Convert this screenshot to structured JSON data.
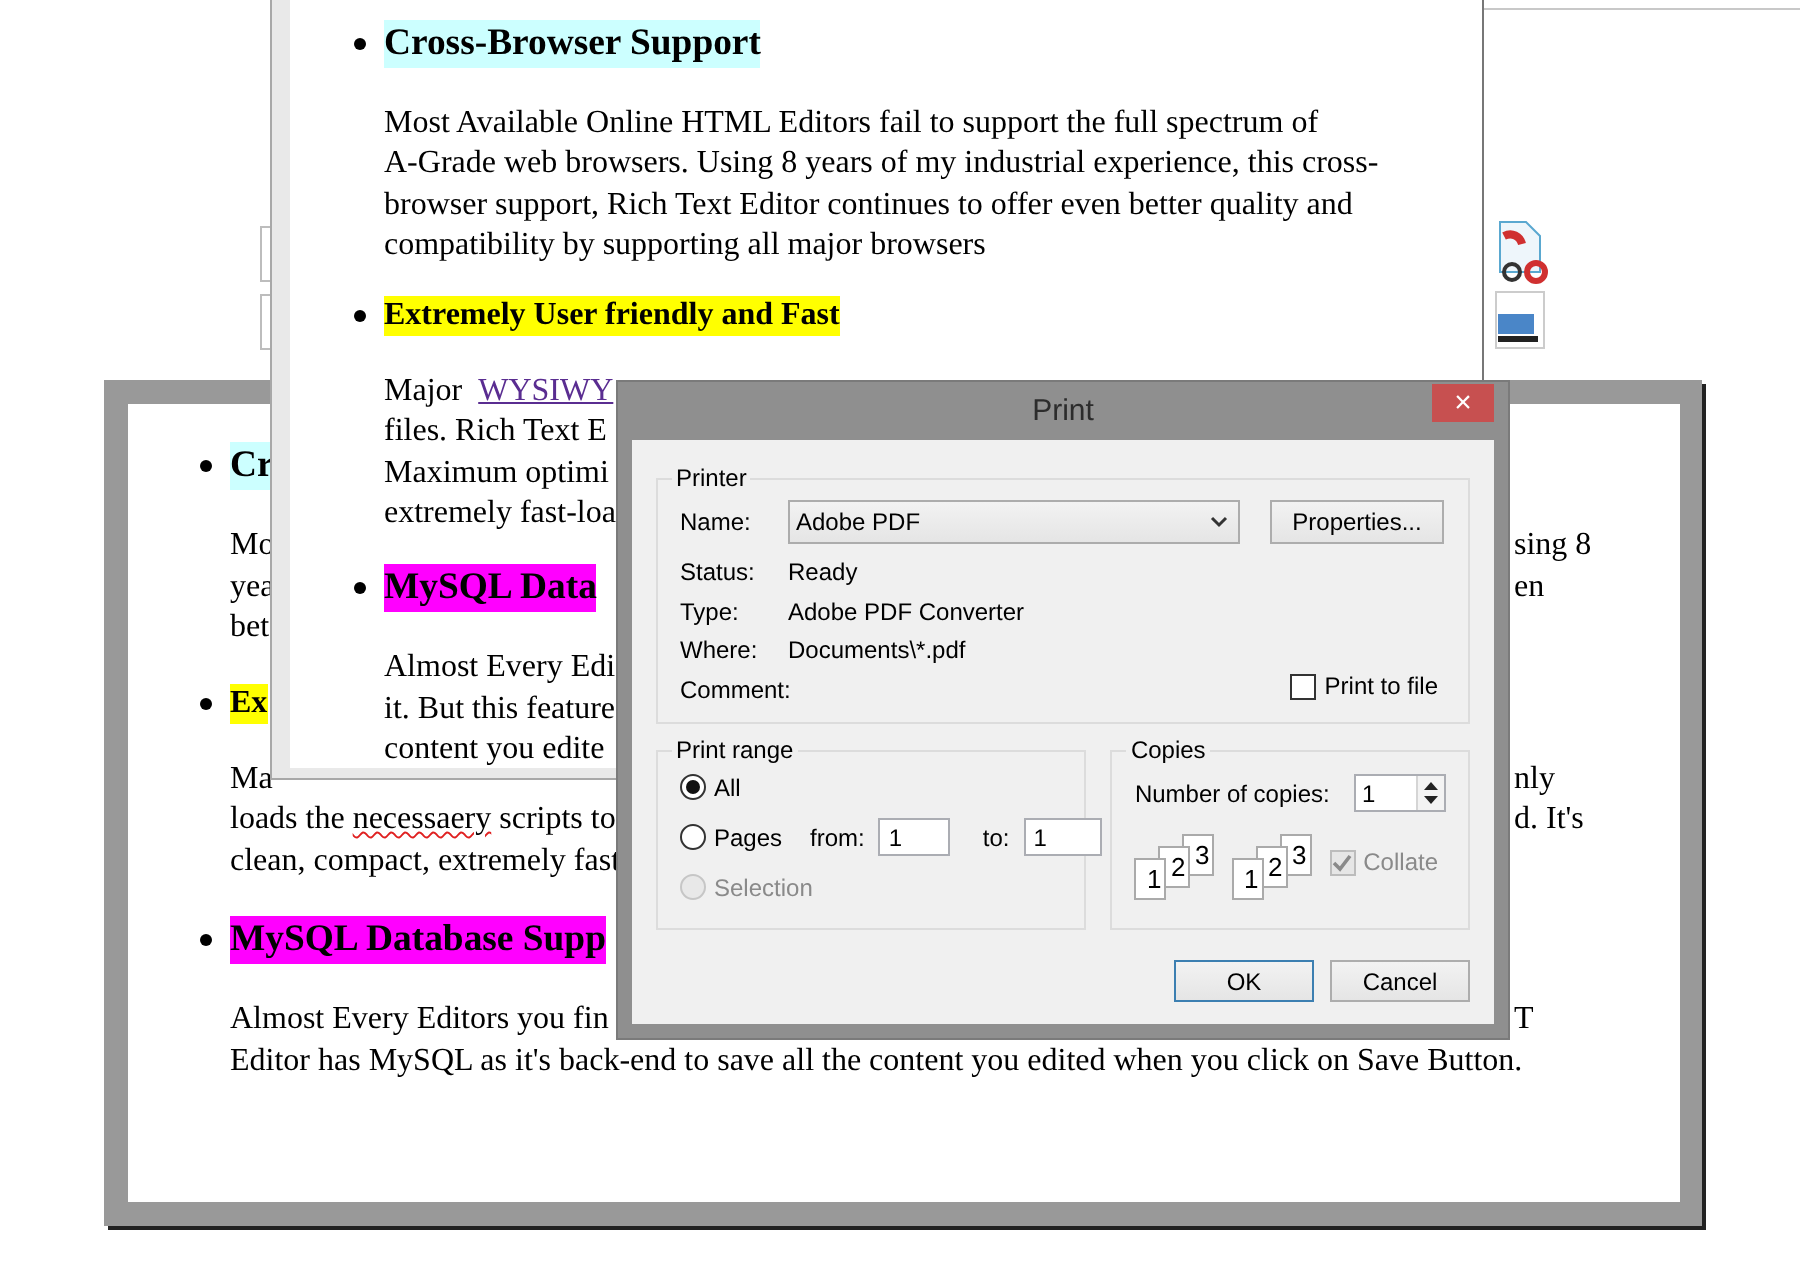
{
  "preview_page": {
    "items": [
      {
        "kind": "heading",
        "color": "#ccffff",
        "text": "Cr"
      },
      {
        "kind": "paragraph",
        "lines": [
          {
            "segments": [
              {
                "kind": "plain",
                "text": "Mo"
              }
            ],
            "right": "sing 8"
          },
          {
            "segments": [
              {
                "kind": "plain",
                "text": "yea"
              }
            ],
            "right": "en"
          },
          {
            "segments": [
              {
                "kind": "plain",
                "text": "bet"
              }
            ]
          }
        ]
      },
      {
        "kind": "subheading",
        "color": "#ffff00",
        "text": "Ex"
      },
      {
        "kind": "paragraph",
        "lines": [
          {
            "segments": [
              {
                "kind": "plain",
                "text": "Ma"
              }
            ],
            "right": "nly"
          },
          {
            "segments": [
              {
                "kind": "plain",
                "text": "loads the "
              },
              {
                "kind": "misspelled",
                "text": "necessaery"
              },
              {
                "kind": "plain",
                "text": " scripts to"
              }
            ],
            "right": "d. It's"
          },
          {
            "segments": [
              {
                "kind": "plain",
                "text": "clean, compact, extremely fast"
              }
            ]
          }
        ]
      },
      {
        "kind": "heading",
        "color": "#ff00ff",
        "text": "MySQL Database Supp"
      },
      {
        "kind": "paragraph",
        "lines": [
          {
            "segments": [
              {
                "kind": "plain",
                "text": "Almost Every Editors you fin"
              }
            ],
            "right": "T"
          },
          {
            "segments": [
              {
                "kind": "plain",
                "text": "Editor has MySQL as it's back-end to save all the content you edited when you click on Save Button."
              }
            ]
          }
        ]
      }
    ]
  },
  "editor_window": {
    "items": [
      {
        "kind": "heading",
        "color": "#ccffff",
        "text": "Cross-Browser Support"
      },
      {
        "kind": "paragraph",
        "lines": [
          {
            "segments": [
              {
                "kind": "plain",
                "text": "Most Available Online HTML Editors fail to support the full spectrum of"
              }
            ]
          },
          {
            "segments": [
              {
                "kind": "plain",
                "text": "A-Grade web browsers. Using 8 years of my industrial experience, this cross-"
              }
            ]
          },
          {
            "segments": [
              {
                "kind": "plain",
                "text": "browser support, Rich Text Editor continues to offer even better quality and"
              }
            ]
          },
          {
            "segments": [
              {
                "kind": "plain",
                "text": "compatibility by supporting all major browsers"
              }
            ]
          }
        ]
      },
      {
        "kind": "subheading",
        "color": "#ffff00",
        "text": "Extremely User friendly and Fast"
      },
      {
        "kind": "paragraph",
        "lines": [
          {
            "segments": [
              {
                "kind": "plain",
                "text": "Major  "
              },
              {
                "kind": "link",
                "text": "WYSIWY"
              }
            ]
          },
          {
            "segments": [
              {
                "kind": "plain",
                "text": "files. Rich Text E"
              }
            ]
          },
          {
            "segments": [
              {
                "kind": "plain",
                "text": "Maximum optimi"
              }
            ]
          },
          {
            "segments": [
              {
                "kind": "plain",
                "text": "extremely fast-loa"
              }
            ]
          }
        ]
      },
      {
        "kind": "heading",
        "color": "#ff00ff",
        "text": "MySQL Data"
      },
      {
        "kind": "paragraph",
        "lines": [
          {
            "segments": [
              {
                "kind": "plain",
                "text": "Almost Every Edi"
              }
            ]
          },
          {
            "segments": [
              {
                "kind": "plain",
                "text": "it. But this feature"
              }
            ]
          },
          {
            "segments": [
              {
                "kind": "plain",
                "text": "content you edite"
              }
            ]
          }
        ]
      }
    ]
  },
  "print_dialog": {
    "title": "Print",
    "close": "×",
    "printer": {
      "legend": "Printer",
      "name_label": "Name:",
      "name_value": "Adobe PDF",
      "properties_button": "Properties...",
      "info": [
        {
          "label": "Status:",
          "value": "Ready"
        },
        {
          "label": "Type:",
          "value": "Adobe PDF Converter"
        },
        {
          "label": "Where:",
          "value": "Documents\\*.pdf"
        },
        {
          "label": "Comment:"
        }
      ],
      "print_to_file": {
        "label": "Print to file",
        "checked": false
      }
    },
    "print_range": {
      "legend": "Print range",
      "options": [
        {
          "label": "All",
          "selected": true,
          "disabled": false
        },
        {
          "label": "Pages",
          "selected": false,
          "disabled": false
        },
        {
          "label": "Selection",
          "selected": false,
          "disabled": true
        }
      ],
      "from_label": "from:",
      "from_value": "1",
      "to_label": "to:",
      "to_value": "1"
    },
    "copies": {
      "legend": "Copies",
      "count_label": "Number of copies:",
      "count_value": "1",
      "collate_icons": [
        {
          "pages": [
            "1",
            "2",
            "3"
          ]
        },
        {
          "pages": [
            "1",
            "2",
            "3"
          ]
        }
      ],
      "collate": {
        "label": "Collate",
        "checked": true,
        "disabled": true
      }
    },
    "buttons": [
      {
        "label": "OK",
        "default": true
      },
      {
        "label": "Cancel",
        "default": false
      }
    ]
  }
}
